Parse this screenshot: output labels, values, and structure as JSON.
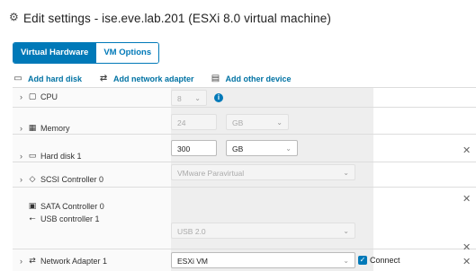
{
  "window": {
    "title": "Edit settings - ise.eve.lab.201 (ESXi 8.0 virtual machine)",
    "icon": "settings-icon"
  },
  "tabs": [
    {
      "label": "Virtual Hardware",
      "active": true
    },
    {
      "label": "VM Options",
      "active": false
    }
  ],
  "toolbar": {
    "add_hard_disk": "Add hard disk",
    "add_network_adapter": "Add network adapter",
    "add_other_device": "Add other device"
  },
  "rows": {
    "cpu": {
      "label": "CPU",
      "value": "8"
    },
    "memory": {
      "label": "Memory",
      "value": "24",
      "unit": "GB"
    },
    "hard_disk": {
      "label": "Hard disk 1",
      "value": "300",
      "unit": "GB"
    },
    "scsi": {
      "label": "SCSI Controller 0",
      "value": "VMware Paravirtual"
    },
    "sata": {
      "label": "SATA Controller 0"
    },
    "usb": {
      "label": "USB controller 1",
      "value": "USB 2.0"
    },
    "network": {
      "label": "Network Adapter 1",
      "value": "ESXi VM",
      "connect_label": "Connect",
      "connected": true
    }
  },
  "colors": {
    "accent": "#0079b8",
    "link": "#0072a3"
  }
}
